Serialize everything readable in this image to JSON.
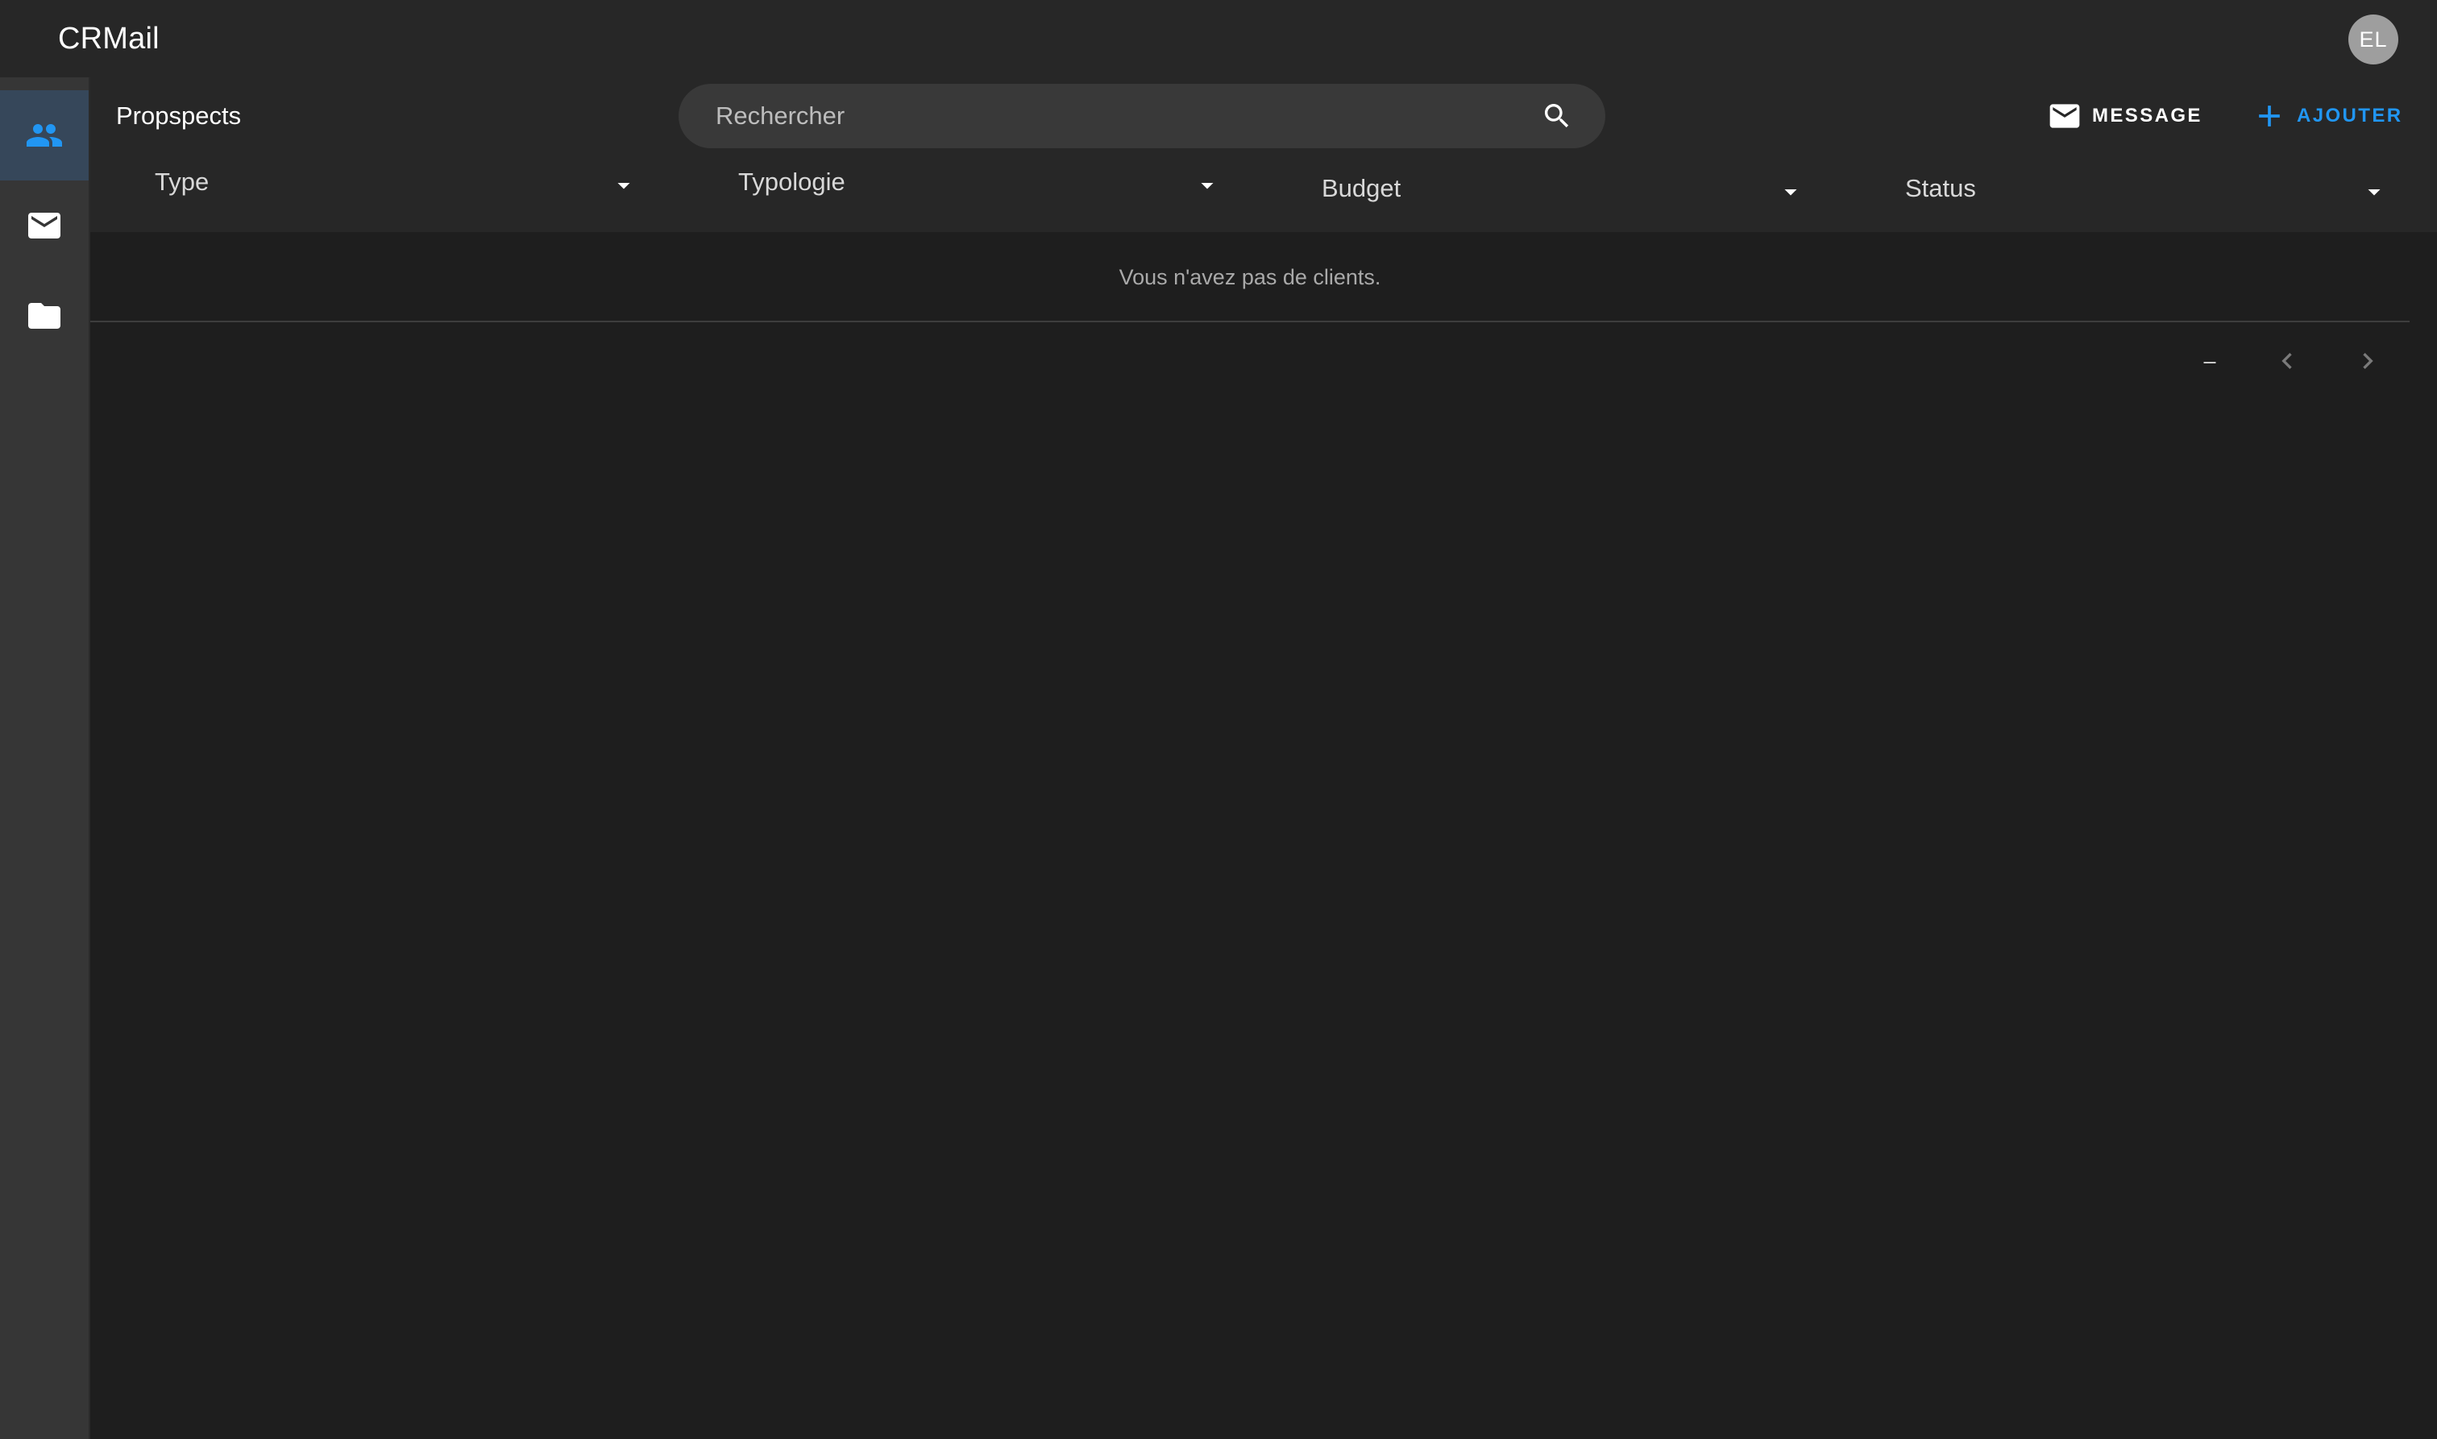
{
  "app": {
    "title": "CRMail",
    "avatar_initials": "EL"
  },
  "sidebar": {
    "items": [
      {
        "name": "prospects",
        "icon": "people-icon",
        "active": true
      },
      {
        "name": "messages",
        "icon": "mail-icon",
        "active": false
      },
      {
        "name": "files",
        "icon": "folder-icon",
        "active": false
      }
    ]
  },
  "toolbar": {
    "page_title": "Propspects",
    "search_placeholder": "Rechercher",
    "message_label": "MESSAGE",
    "add_label": "AJOUTER"
  },
  "filters": {
    "type": "Type",
    "typologie": "Typologie",
    "budget": "Budget",
    "status": "Status"
  },
  "table": {
    "empty_message": "Vous n'avez pas de clients.",
    "page_range": "–"
  },
  "colors": {
    "accent": "#2196f3",
    "appbar": "#272727",
    "background": "#1e1e1e",
    "sidebar": "#363636",
    "sidebar_active": "#36475a"
  }
}
